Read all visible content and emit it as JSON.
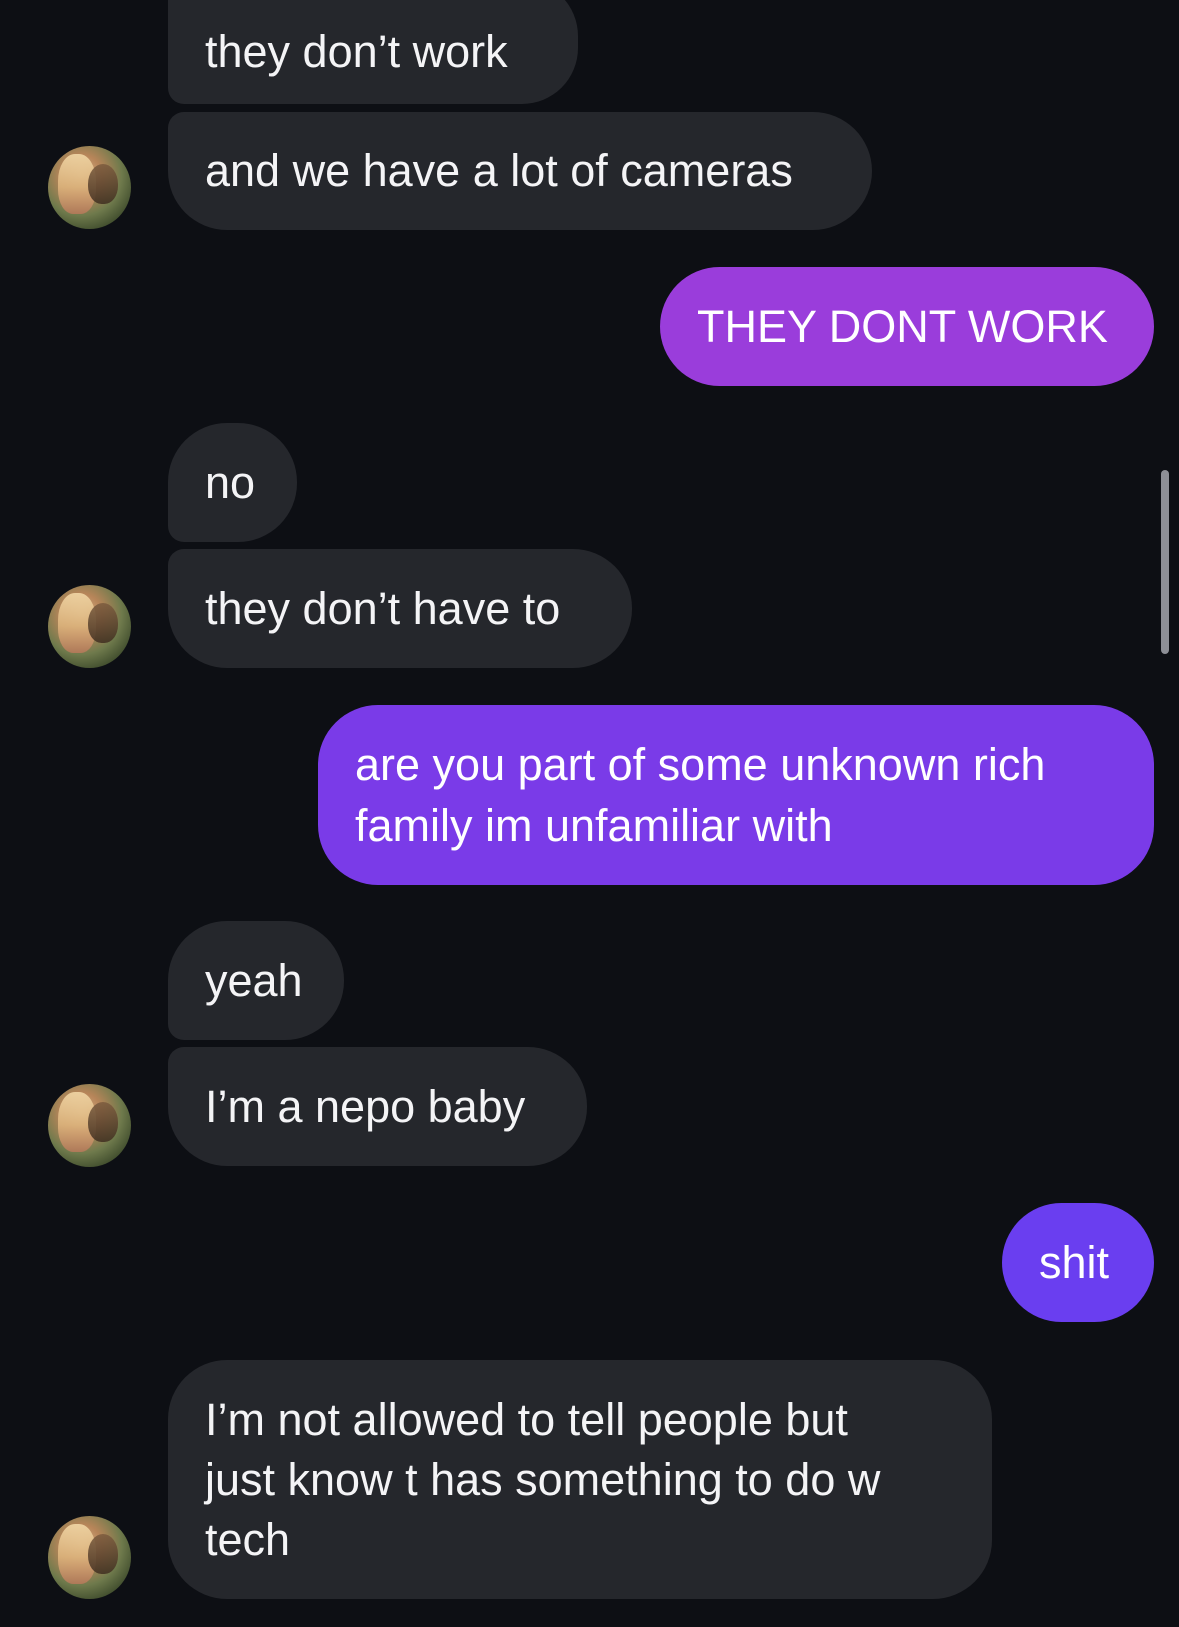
{
  "chat": {
    "messages": [
      {
        "sender": "them",
        "text": "they don’t work"
      },
      {
        "sender": "them",
        "text": "and we have a lot of cameras"
      },
      {
        "sender": "me",
        "text": "THEY DONT WORK"
      },
      {
        "sender": "them",
        "text": "no"
      },
      {
        "sender": "them",
        "text": "they don’t have to"
      },
      {
        "sender": "me",
        "text": "are you part of some unknown rich\nfamily im unfamiliar with"
      },
      {
        "sender": "them",
        "text": "yeah"
      },
      {
        "sender": "them",
        "text": "I’m a nepo baby"
      },
      {
        "sender": "me",
        "text": "shit"
      },
      {
        "sender": "them",
        "text": "I’m not allowed to tell people but\njust know t has something to do w\ntech"
      }
    ]
  },
  "colors": {
    "background": "#0d0f14",
    "incoming_bubble": "#25272c",
    "outgoing_gradient_top": "#9a3ddb",
    "outgoing_gradient_mid": "#7a3be8",
    "outgoing_gradient_bottom": "#6a3ef0",
    "text": "#f4f4f6"
  },
  "icons": {
    "avatar": "contact-avatar-icon",
    "scroll": "scrollbar-thumb"
  }
}
